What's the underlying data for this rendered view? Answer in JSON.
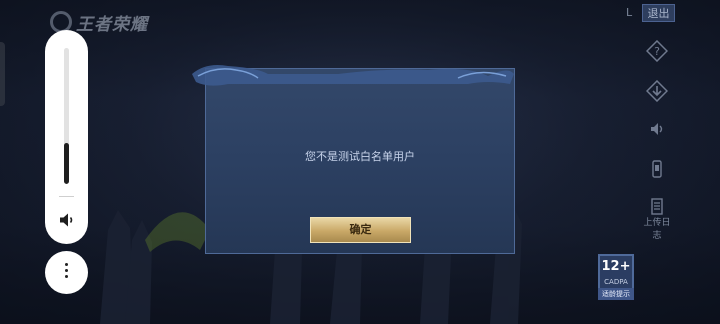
{
  "game": {
    "logo_text": "王者荣耀",
    "exit_label": "退出",
    "exit_prefix": "L"
  },
  "dialog": {
    "message": "您不是测试白名单用户",
    "confirm_label": "确定"
  },
  "right_toolbar": {
    "icons": [
      "help-icon",
      "download-icon",
      "volume-icon",
      "device-icon",
      "log-icon"
    ],
    "log_label": "上传日志"
  },
  "age_rating": {
    "rating": "12+",
    "subtitle": "CADPA",
    "footer": "适龄提示"
  },
  "volume_panel": {
    "level": 0.3,
    "icon": "speaker-icon",
    "more_icon": "more-vertical-icon"
  },
  "colors": {
    "dialog_bg": "#2c4062",
    "confirm_gold": "#c9a867",
    "panel_white": "#ffffff"
  }
}
